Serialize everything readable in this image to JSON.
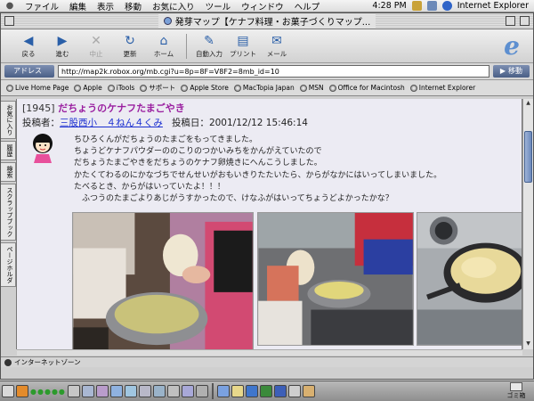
{
  "menubar": {
    "items": [
      "ファイル",
      "編集",
      "表示",
      "移動",
      "お気に入り",
      "ツール",
      "ウィンドウ",
      "ヘルプ"
    ],
    "clock": "4:28 PM",
    "app_name": "Internet Explorer"
  },
  "window": {
    "title": "発芽マップ【ケナフ料理・お菓子づくりマップ..."
  },
  "toolbar": {
    "back": "戻る",
    "forward": "進む",
    "stop": "中止",
    "refresh": "更新",
    "home": "ホーム",
    "autofill": "自動入力",
    "print": "プリント",
    "mail": "メール"
  },
  "address": {
    "label": "アドレス",
    "url": "http://map2k.robox.org/mb.cgi?u=8p=8F=V8F2=8mb_id=10",
    "go": "移動"
  },
  "favorites": [
    "Live Home Page",
    "Apple",
    "iTools",
    "サポート",
    "Apple Store",
    "MacTopia Japan",
    "MSN",
    "Office for Macintosh",
    "Internet Explorer"
  ],
  "sidetabs": [
    "お気に入り",
    "履歴",
    "検索",
    "スクラップブック",
    "ページホルダ"
  ],
  "post": {
    "number": "[1945]",
    "title": "だちょうのケナフたまごやき",
    "poster_label": "投稿者：",
    "poster": "三股西小　４ねん４くみ",
    "date_label": "投稿日：",
    "date": "2001/12/12 15:46:14",
    "body": [
      "ちひろくんがだちょうのたまごをもってきました。",
      "ちょうどケナフパウダーののこりのつかいみちをかんがえていたので",
      "だちょうたまごやきをだちょうのケナフ卵焼きにへんこうしました。",
      "かたくてわるのにかなづちでせんせいがおもいきりたたいたら、からがなかにはいってしまいました。",
      "たべるとき、からがはいっていたよ！！！",
      "　ふつうのたまごよりあじがうすかったので、けなふがはいってちょうどよかったかな？"
    ]
  },
  "status": {
    "zone": "インターネットゾーン"
  },
  "dock": {
    "trash_label": "ゴミ箱"
  },
  "colors": {
    "title_purple": "#9a1fa0",
    "link_blue": "#1a2ed0",
    "content_bg": "#ecebf3"
  }
}
